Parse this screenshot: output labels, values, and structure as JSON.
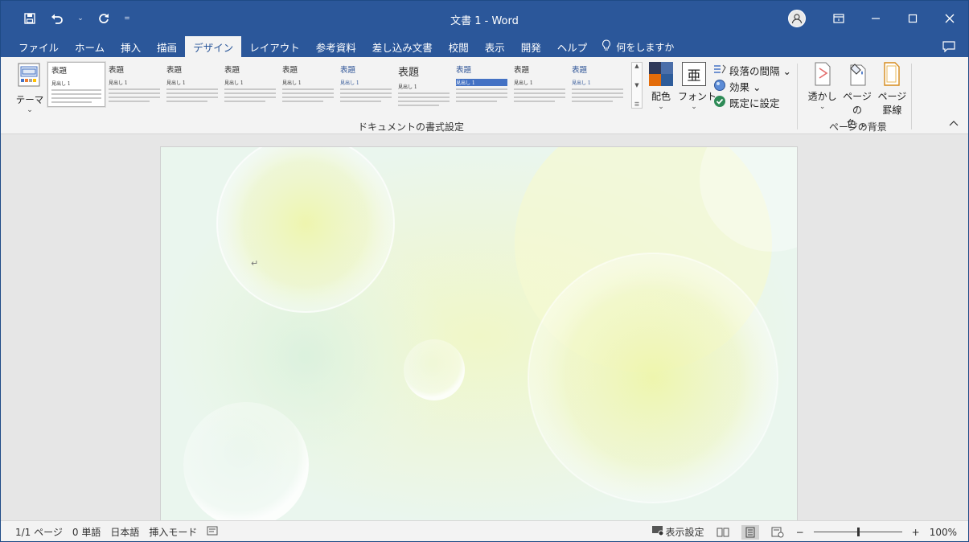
{
  "window": {
    "title": "文書 1  -  Word",
    "qat_customize": "=",
    "undo_dropdown": "⌄"
  },
  "tabs": [
    "ファイル",
    "ホーム",
    "挿入",
    "描画",
    "デザイン",
    "レイアウト",
    "参考資料",
    "差し込み文書",
    "校閲",
    "表示",
    "開発",
    "ヘルプ"
  ],
  "active_tab": "デザイン",
  "tell_me": "何をしますか",
  "ribbon": {
    "theme_label": "テーマ",
    "theme_chevron": "⌄",
    "gallery_styles": [
      {
        "title": "表題",
        "heading": "見出し 1",
        "variant": "sel"
      },
      {
        "title": "表題",
        "heading": "見出し 1",
        "variant": ""
      },
      {
        "title": "表題",
        "heading": "見出し 1",
        "variant": ""
      },
      {
        "title": "表題",
        "heading": "見出し 1",
        "variant": ""
      },
      {
        "title": "表題",
        "heading": "見出し 1",
        "variant": ""
      },
      {
        "title": "表題",
        "heading": "見出し 1",
        "variant": "blue"
      },
      {
        "title": "表題",
        "heading": "見出し 1",
        "variant": "big"
      },
      {
        "title": "表題",
        "heading": "見出し 1",
        "variant": "blue hl"
      },
      {
        "title": "表題",
        "heading": "見出し 1",
        "variant": ""
      },
      {
        "title": "表題",
        "heading": "見出し 1",
        "variant": "blue"
      }
    ],
    "colors_label": "配色",
    "fonts_label": "フォント",
    "fonts_glyph": "亜",
    "paragraph_spacing": "段落の間隔 ⌄",
    "effects": "効果 ⌄",
    "set_default": "既定に設定",
    "group_document_formatting": "ドキュメントの書式設定",
    "watermark": "透かし",
    "page_color_1": "ページの",
    "page_color_2": "色 ⌄",
    "page_borders_1": "ページ",
    "page_borders_2": "罫線",
    "group_page_background": "ページの背景",
    "theme_colors": [
      "#2f3a5a",
      "#4a6ea9",
      "#e36c0a",
      "#2e5c9a"
    ]
  },
  "document": {
    "paragraph_mark": "↵"
  },
  "status": {
    "page": "1/1 ページ",
    "words": "0 単語",
    "language": "日本語",
    "mode": "挿入モード",
    "display_settings": "表示設定",
    "zoom_minus": "−",
    "zoom_plus": "+",
    "zoom": "100%",
    "zoom_level": 0.5
  }
}
